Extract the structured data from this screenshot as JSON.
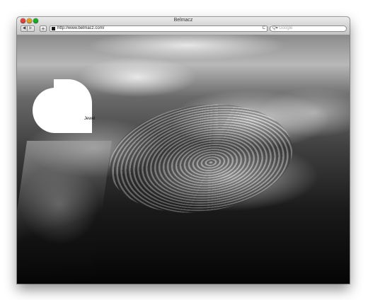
{
  "window": {
    "title": "Belmacz"
  },
  "toolbar": {
    "back_label": "◀",
    "forward_label": "▶",
    "add_label": "+",
    "url": "http://www.belmacz.com/",
    "reload_label": "C",
    "search_placeholder": "Google",
    "search_icon_label": "Q▾"
  },
  "page": {
    "nav_link": "Jewel"
  }
}
